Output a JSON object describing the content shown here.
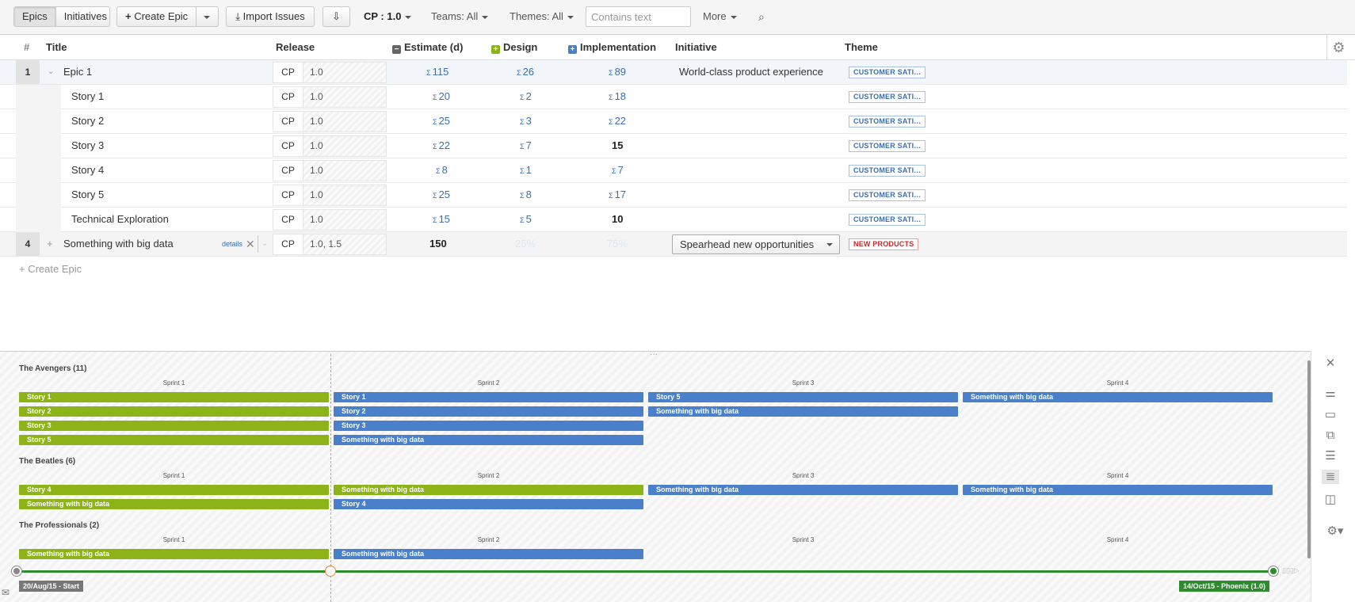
{
  "toolbar": {
    "view_tabs": [
      "Epics",
      "Initiatives"
    ],
    "create_epic": "Create Epic",
    "import_issues": "Import Issues",
    "release_filter": "CP : 1.0",
    "teams_filter": "Teams: All",
    "themes_filter": "Themes: All",
    "search_placeholder": "Contains text",
    "more": "More"
  },
  "columns": {
    "num": "#",
    "title": "Title",
    "release": "Release",
    "estimate": "Estimate (d)",
    "design": "Design",
    "implementation": "Implementation",
    "initiative": "Initiative",
    "theme": "Theme"
  },
  "rows": [
    {
      "num": "1",
      "title": "Epic 1",
      "project": "CP",
      "release": "1.0",
      "estimate": "115",
      "design": "26",
      "impl": "89",
      "initiative": "World-class product experience",
      "theme": "CUSTOMER SATI…"
    },
    {
      "title": "Story 1",
      "project": "CP",
      "release": "1.0",
      "estimate": "20",
      "design": "2",
      "impl": "18",
      "theme": "CUSTOMER SATI…"
    },
    {
      "title": "Story 2",
      "project": "CP",
      "release": "1.0",
      "estimate": "25",
      "design": "3",
      "impl": "22",
      "theme": "CUSTOMER SATI…"
    },
    {
      "title": "Story 3",
      "project": "CP",
      "release": "1.0",
      "estimate": "22",
      "design": "7",
      "impl": "15",
      "theme": "CUSTOMER SATI…"
    },
    {
      "title": "Story 4",
      "project": "CP",
      "release": "1.0",
      "estimate": "8",
      "design": "1",
      "impl": "7",
      "theme": "CUSTOMER SATI…"
    },
    {
      "title": "Story 5",
      "project": "CP",
      "release": "1.0",
      "estimate": "25",
      "design": "8",
      "impl": "17",
      "theme": "CUSTOMER SATI…"
    },
    {
      "title": "Technical Exploration",
      "project": "CP",
      "release": "1.0",
      "estimate": "15",
      "design": "5",
      "impl": "10",
      "theme": "CUSTOMER SATI…"
    },
    {
      "num": "4",
      "title": "Something with big data",
      "details": "details",
      "project": "CP",
      "release": "1.0, 1.5",
      "estimate": "150",
      "design": "25%",
      "impl": "75%",
      "initiative": "Spearhead new opportunities",
      "theme": "NEW PRODUCTS"
    }
  ],
  "create_epic_link": "+ Create Epic",
  "timeline": {
    "groups": [
      {
        "name": "The Avengers (11)",
        "sprints": [
          "Sprint 1",
          "Sprint 2",
          "Sprint 3",
          "Sprint 4"
        ],
        "bars": [
          [
            "Story 1",
            "Story 1",
            "Story 5",
            "Something with big data"
          ],
          [
            "Story 2",
            "Story 2",
            "Something with big data"
          ],
          [
            "Story 3",
            "Story 3"
          ],
          [
            "Story 5",
            "Something with big data"
          ]
        ]
      },
      {
        "name": "The Beatles (6)",
        "sprints": [
          "Sprint 1",
          "Sprint 2",
          "Sprint 3",
          "Sprint 4"
        ],
        "bars": [
          [
            "Story 4",
            "Something with big data",
            "Something with big data",
            "Something with big data"
          ],
          [
            "Something with big data",
            "Story 4"
          ]
        ]
      },
      {
        "name": "The Professionals (2)",
        "sprints": [
          "Sprint 1",
          "Sprint 2",
          "Sprint 3",
          "Sprint 4"
        ],
        "bars": [
          [
            "Something with big data",
            "Something with big data"
          ]
        ]
      }
    ],
    "start_label": "20/Aug/15 - Start",
    "end_label": "14/Oct/15 - Phoenix (1.0)"
  },
  "colors": {
    "done": "#8cb318",
    "planned": "#4a80c9",
    "timeline_axis": "#2e8b2e"
  }
}
